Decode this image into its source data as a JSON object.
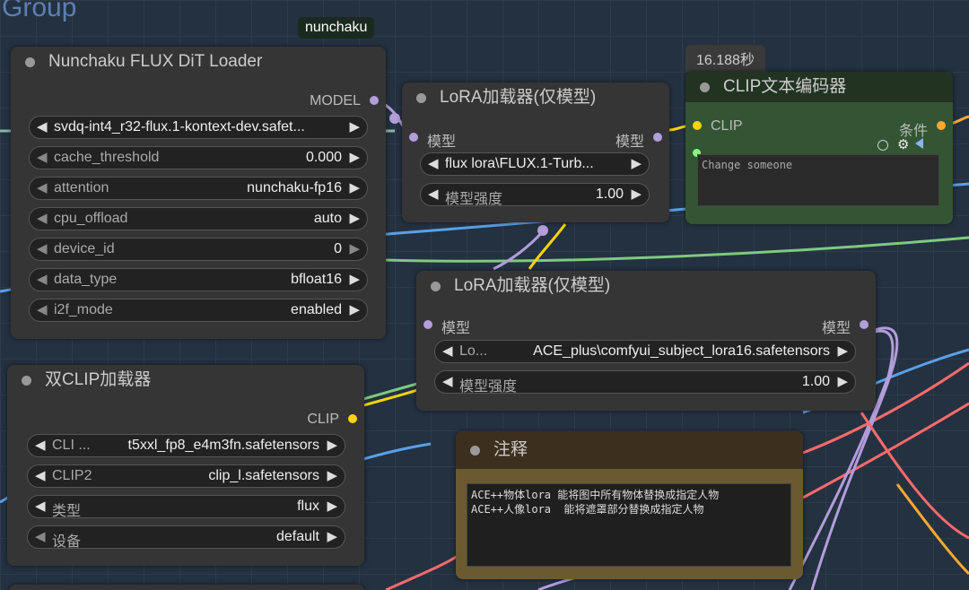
{
  "group": {
    "title": "Group"
  },
  "badge": "nunchaku",
  "timer": "16.188秒",
  "dit_loader": {
    "title": "Nunchaku FLUX DiT Loader",
    "output": "MODEL",
    "model_path": "svdq-int4_r32-flux.1-kontext-dev.safet...",
    "widgets": [
      {
        "label": "cache_threshold",
        "value": "0.000"
      },
      {
        "label": "attention",
        "value": "nunchaku-fp16"
      },
      {
        "label": "cpu_offload",
        "value": "auto"
      },
      {
        "label": "device_id",
        "value": "0"
      },
      {
        "label": "data_type",
        "value": "bfloat16"
      },
      {
        "label": "i2f_mode",
        "value": "enabled"
      }
    ]
  },
  "lora1": {
    "title": "LoRA加载器(仅模型)",
    "input": "模型",
    "output": "模型",
    "lora": "flux lora\\FLUX.1-Turb...",
    "strength_label": "模型强度",
    "strength": "1.00"
  },
  "clip_encoder": {
    "title": "CLIP文本编码器",
    "input": "CLIP",
    "output": "条件",
    "text": "Change someone"
  },
  "lora2": {
    "title": "LoRA加载器(仅模型)",
    "input": "模型",
    "output": "模型",
    "lora_label": "Lo...",
    "lora": "ACE_plus\\comfyui_subject_lora16.safetensors",
    "strength_label": "模型强度",
    "strength": "1.00"
  },
  "dual_clip": {
    "title": "双CLIP加载器",
    "output": "CLIP",
    "widgets": [
      {
        "label": "CLI ...",
        "value": "t5xxl_fp8_e4m3fn.safetensors"
      },
      {
        "label": "CLIP2",
        "value": "clip_l.safetensors"
      },
      {
        "label": "类型",
        "value": "flux"
      },
      {
        "label": "设备",
        "value": "default"
      }
    ]
  },
  "note": {
    "title": "注释",
    "text": "ACE++物体lora 能将图中所有物体替换成指定人物\nACE++人像lora  能将遮罩部分替换成指定人物"
  },
  "colors": {
    "model": "#b39ddb",
    "clip": "#ffd500",
    "conditioning": "#ffa931",
    "note_bg": "#6b5a2f",
    "clip_node_bg": "#335533"
  }
}
